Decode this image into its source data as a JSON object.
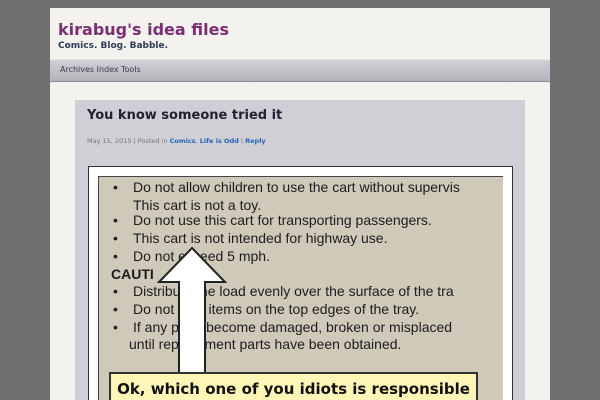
{
  "site": {
    "title": "kirabug's idea files",
    "description": "Comics. Blog. Babble."
  },
  "nav": {
    "items": [
      {
        "label": "Archives Index"
      },
      {
        "label": "Tools"
      }
    ]
  },
  "post": {
    "title": "You know someone tried it",
    "meta": {
      "date": "May 15, 2015",
      "posted_in_label": "| Posted in",
      "category_1": "Comics",
      "separator": ",",
      "category_2": "Life is Odd",
      "pipe": "|",
      "reply": "Reply"
    },
    "comic": {
      "photo_lines": [
        {
          "bullet": "•",
          "text": "Do not allow children to use the cart without supervis"
        },
        {
          "bullet": "",
          "text": "This cart is not a toy."
        },
        {
          "bullet": "•",
          "text": "Do not use this cart for transporting passengers."
        },
        {
          "bullet": "•",
          "text": "This cart is not intended for highway use."
        },
        {
          "bullet": "•",
          "text": "Do not exceed 5 mph."
        },
        {
          "bullet": "",
          "text": "CAUTI"
        },
        {
          "bullet": "•",
          "text": "Distribute the load evenly over the surface of the tra"
        },
        {
          "bullet": "•",
          "text": "Do not load items on the top edges of the tray."
        },
        {
          "bullet": "•",
          "text": "If any parts become damaged, broken or misplaced"
        },
        {
          "bullet": "",
          "text": "until replacement parts have been obtained."
        }
      ],
      "caption": "Ok, which one of you idiots is responsible"
    }
  }
}
